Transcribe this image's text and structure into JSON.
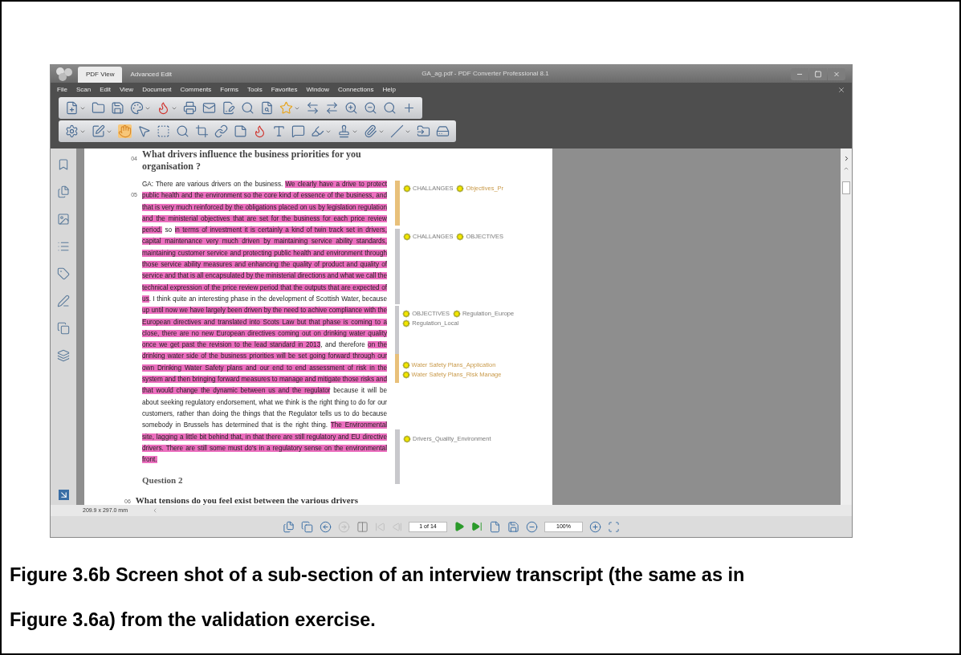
{
  "window": {
    "title": "GA_ag.pdf - PDF Converter Professional 8.1"
  },
  "tabs": [
    {
      "label": "PDF View",
      "selected": true
    },
    {
      "label": "Advanced Edit",
      "selected": false
    }
  ],
  "menu": [
    "File",
    "Scan",
    "Edit",
    "View",
    "Document",
    "Comments",
    "Forms",
    "Tools",
    "Favorites",
    "Window",
    "Connections",
    "Help"
  ],
  "document": {
    "question_number": "04",
    "question": "What drivers influence the business priorities for you organisation ?",
    "answer_number": "05",
    "answer": [
      {
        "text": "GA:  There are various drivers on the business.  ",
        "highlighted": false
      },
      {
        "text": "We clearly have a drive to protect public health and the environment so the core kind of essence of the business, and that is very much reinforced by the obligations placed on us by legislation regulation and the ministerial objectives that are set for the business for each price review period.",
        "highlighted": true
      },
      {
        "text": " so ",
        "highlighted": false
      },
      {
        "text": "in terms of investment it is certainly a kind of twin track set in drivers, capital maintenance very much driven by maintaining service ability standards, maintaining customer service and protecting public health and environment through those service ability measures and enhancing the quality of product and quality of service and that is all encapsulated by the ministerial directions and what we call the technical expression of the price review period that the outputs that are expected of us",
        "highlighted": true
      },
      {
        "text": ".  I think quite an interesting phase in the development of Scottish Water, because ",
        "highlighted": false
      },
      {
        "text": "up until now we have largely been driven by the need to achive compliance with the European directives and translated into Scots Law but that phase is coming to a close, there are no new European directives coming out on drinking water quality once we get past the revision to the lead standard in 2013",
        "highlighted": true
      },
      {
        "text": ", and therefore ",
        "highlighted": false
      },
      {
        "text": "on the drinking water side of the business priorities will be set going forward through our own Drinking Water Safety plans and our end to end assessment of risk in the system and then bringing forward measures to manage and mitigate those risks and that would change the dynamic between us and the regulator",
        "highlighted": true
      },
      {
        "text": " because it will be about seeking regulatory endorsement, what we think is the right thing to do for our customers, rather than doing the things that the Regulator tells us to do because somebody in Brussels has determined that is the right thing.  ",
        "highlighted": false
      },
      {
        "text": "The Environmental site, lagging a little bit behind that, in that there are still regulatory and EU directive drivers. There are still some must do's in a regulatory sense on the environmental front.",
        "highlighted": true
      }
    ],
    "heading": "Question 2",
    "next_number": "06",
    "next_question": "What tensions do you feel exist between the various drivers"
  },
  "code_groups": [
    {
      "color": "#e8c07a",
      "codes": [
        {
          "label": "CHALLANGES",
          "emphasized": false
        },
        {
          "label": "Objectives_Pr",
          "emphasized": true
        }
      ]
    },
    {
      "color": "#c8c8cc",
      "codes": [
        {
          "label": "CHALLANGES",
          "emphasized": false
        },
        {
          "label": "OBJECTIVES",
          "emphasized": false
        }
      ]
    },
    {
      "color": "#c8c8cc",
      "codes": [
        {
          "label": "OBJECTIVES",
          "emphasized": false
        },
        {
          "label": "Regulation_Europe",
          "emphasized": false
        },
        {
          "label": "Regulation_Local",
          "emphasized": false
        }
      ]
    },
    {
      "color": "#e8c07a",
      "codes": [
        {
          "label": "Water Safety Plans_Application",
          "emphasized": true
        },
        {
          "label": "Water Safety Plans_Risk Manage",
          "emphasized": true
        }
      ]
    },
    {
      "color": "#c8c8cc",
      "codes": [
        {
          "label": "Drivers_Quality_Environment",
          "emphasized": false
        }
      ]
    }
  ],
  "status_bar": {
    "page_size": "209.9 x 297.0 mm",
    "page": "1 of 14",
    "zoom": "100%"
  },
  "caption": "Figure 3.6b Screen shot of a sub-section of an interview transcript (the same as in Figure 3.6a) from the validation exercise."
}
